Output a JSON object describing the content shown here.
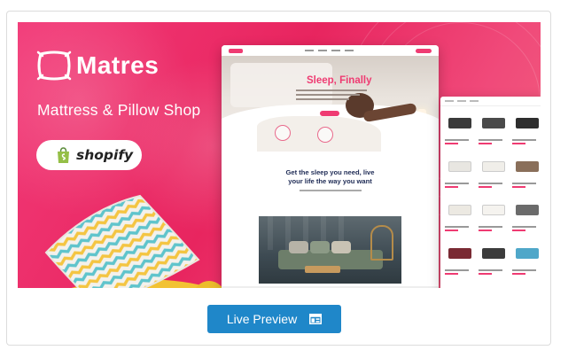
{
  "banner": {
    "brand": "Matres",
    "tagline": "Mattress & Pillow Shop",
    "platform": "shopify",
    "colors": {
      "gradient_start": "#f23a78",
      "gradient_end": "#f3667f",
      "accent": "#ef3b72"
    }
  },
  "preview": {
    "hero_title": "Sleep, Finally",
    "section_title_line1": "Get the sleep you need, live",
    "section_title_line2": "your life the way you want"
  },
  "actions": {
    "live_preview_label": "Live Preview",
    "live_preview_icon": "layout-icon",
    "button_color": "#1f87c9"
  }
}
